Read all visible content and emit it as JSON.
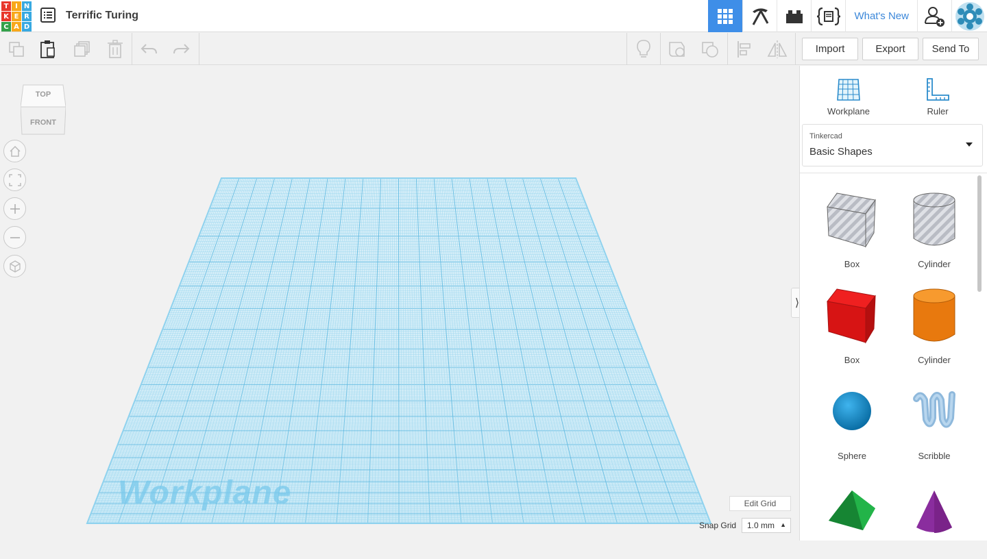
{
  "app": {
    "logo_letters": [
      "T",
      "I",
      "N",
      "K",
      "E",
      "R",
      "C",
      "A",
      "D"
    ],
    "logo_colors": [
      "#e8362b",
      "#f8a81b",
      "#37a9e1",
      "#e8362b",
      "#f8a81b",
      "#37a9e1",
      "#33a14a",
      "#f8a81b",
      "#37a9e1"
    ],
    "design_title": "Terrific Turing"
  },
  "topnav": {
    "items": [
      {
        "name": "3d-design-icon",
        "active": true
      },
      {
        "name": "pickaxe-icon",
        "active": false
      },
      {
        "name": "brick-icon",
        "active": false
      },
      {
        "name": "codeblocks-icon",
        "active": false
      }
    ],
    "whats_new": "What's New"
  },
  "toolbar": {
    "import": "Import",
    "export": "Export",
    "send_to": "Send To"
  },
  "viewcube": {
    "top": "TOP",
    "front": "FRONT"
  },
  "workplane": {
    "label": "Workplane",
    "edit_grid": "Edit Grid",
    "snap_grid_label": "Snap Grid",
    "snap_grid_value": "1.0 mm"
  },
  "panel": {
    "workplane_tool": "Workplane",
    "ruler_tool": "Ruler",
    "library_source": "Tinkercad",
    "library_name": "Basic Shapes",
    "shapes": [
      {
        "label": "Box",
        "icon": "box-hole-icon"
      },
      {
        "label": "Cylinder",
        "icon": "cylinder-hole-icon"
      },
      {
        "label": "Box",
        "icon": "box-icon"
      },
      {
        "label": "Cylinder",
        "icon": "cylinder-icon"
      },
      {
        "label": "Sphere",
        "icon": "sphere-icon"
      },
      {
        "label": "Scribble",
        "icon": "scribble-icon"
      },
      {
        "label": "",
        "icon": "roof-icon"
      },
      {
        "label": "",
        "icon": "cone-icon"
      }
    ]
  },
  "colors": {
    "accent": "#3e8ee8",
    "link": "#3b87d9",
    "grid": "#7fcbea"
  }
}
